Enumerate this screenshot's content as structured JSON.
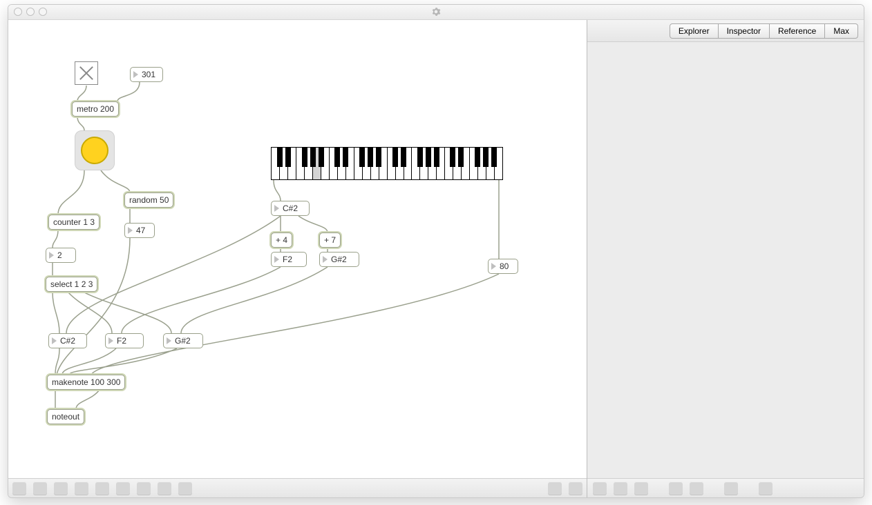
{
  "window": {
    "title": ""
  },
  "sidebar": {
    "tabs": [
      "Explorer",
      "Inspector",
      "Reference",
      "Max"
    ]
  },
  "objects": {
    "metro": {
      "text": "metro 200"
    },
    "msgTempo": {
      "text": "301"
    },
    "random": {
      "text": "random 50"
    },
    "counter": {
      "text": "counter 1 3"
    },
    "num47": {
      "text": "47"
    },
    "num2": {
      "text": "2"
    },
    "select": {
      "text": "select 1 2 3"
    },
    "root": {
      "text": "C#2"
    },
    "plus4": {
      "text": "+ 4"
    },
    "plus7": {
      "text": "+ 7"
    },
    "f2": {
      "text": "F2"
    },
    "gsharp2": {
      "text": "G#2"
    },
    "vel": {
      "text": "80"
    },
    "n1": {
      "text": "C#2"
    },
    "n2": {
      "text": "F2"
    },
    "n3": {
      "text": "G#2"
    },
    "makenote": {
      "text": "makenote 100 300"
    },
    "noteout": {
      "text": "noteout"
    }
  },
  "kslider": {
    "octaves": 4,
    "startNote": "C1",
    "pressedWhiteIndex": 5
  }
}
